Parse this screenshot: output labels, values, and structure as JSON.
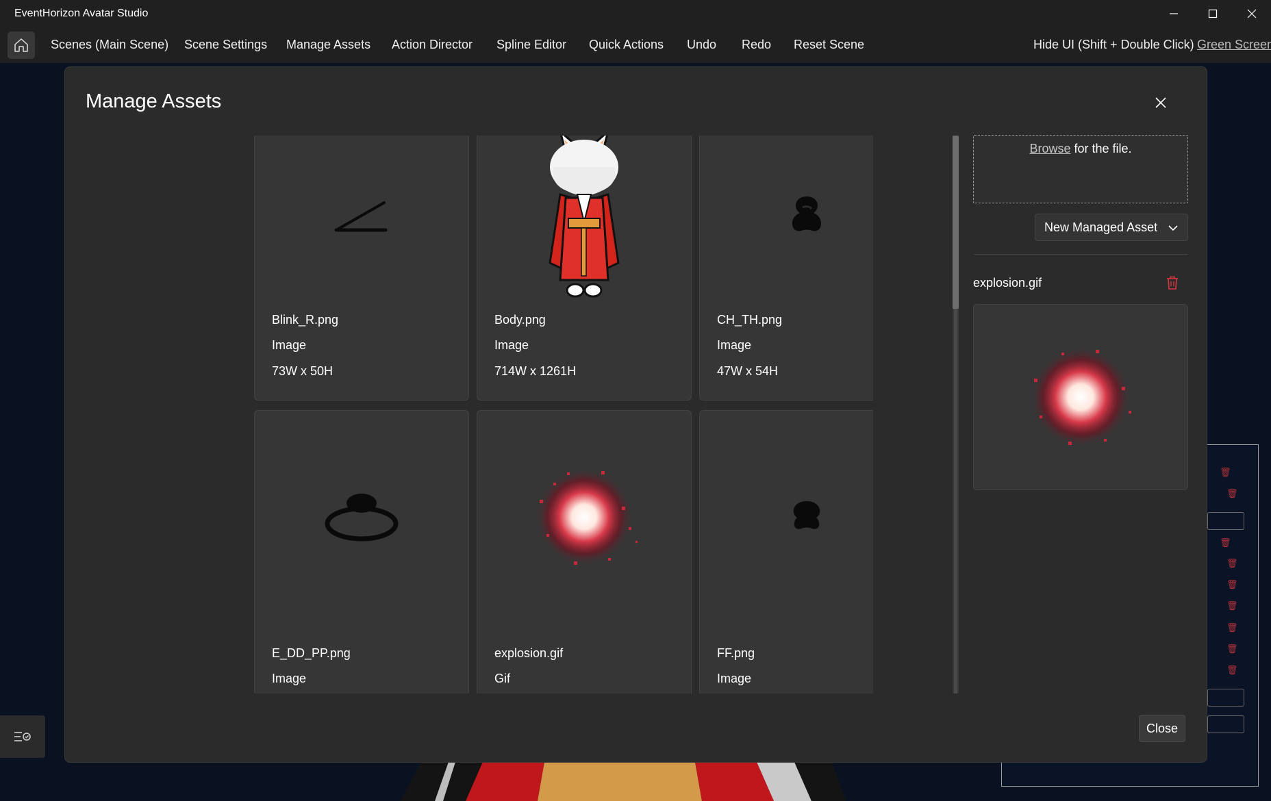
{
  "window": {
    "title": "EventHorizon Avatar Studio",
    "controls": [
      "minimize-icon",
      "maximize-icon",
      "close-icon"
    ]
  },
  "menu": {
    "home_icon": "home-icon",
    "items": [
      "Scenes (Main Scene)",
      "Scene Settings",
      "Manage Assets",
      "Action Director",
      "Spline Editor",
      "Quick Actions",
      "Undo",
      "Redo",
      "Reset Scene"
    ],
    "hide_ui": "Hide UI (Shift + Double Click)",
    "green_screen": "Green Screen"
  },
  "modal": {
    "title": "Manage Assets",
    "close_label": "Close",
    "assets": [
      {
        "name": "Blink_R.png",
        "type": "Image",
        "size": "73W x 50H",
        "icon": "blink-line-thumbnail"
      },
      {
        "name": "Body.png",
        "type": "Image",
        "size": "714W x 1261H",
        "icon": "avatar-body-thumbnail"
      },
      {
        "name": "CH_TH.png",
        "type": "Image",
        "size": "47W x 54H",
        "icon": "mouth-shape-thumbnail"
      },
      {
        "name": "E_DD_PP.png",
        "type": "Image",
        "size": "",
        "icon": "ring-shape-thumbnail"
      },
      {
        "name": "explosion.gif",
        "type": "Gif",
        "size": "",
        "icon": "explosion-thumbnail"
      },
      {
        "name": "FF.png",
        "type": "Image",
        "size": "",
        "icon": "mouth-shape-thumbnail"
      }
    ],
    "upload": {
      "browse": "Browse",
      "rest": " for the file."
    },
    "asset_type": "New Managed Asset",
    "selected": {
      "name": "explosion.gif",
      "delete_icon": "trash-icon"
    },
    "scroll_position": 0.31
  },
  "colors": {
    "background": "#0a1222",
    "chrome": "#202020",
    "modal": "#2b2b2b",
    "card": "#363636",
    "danger": "#d9363e"
  }
}
